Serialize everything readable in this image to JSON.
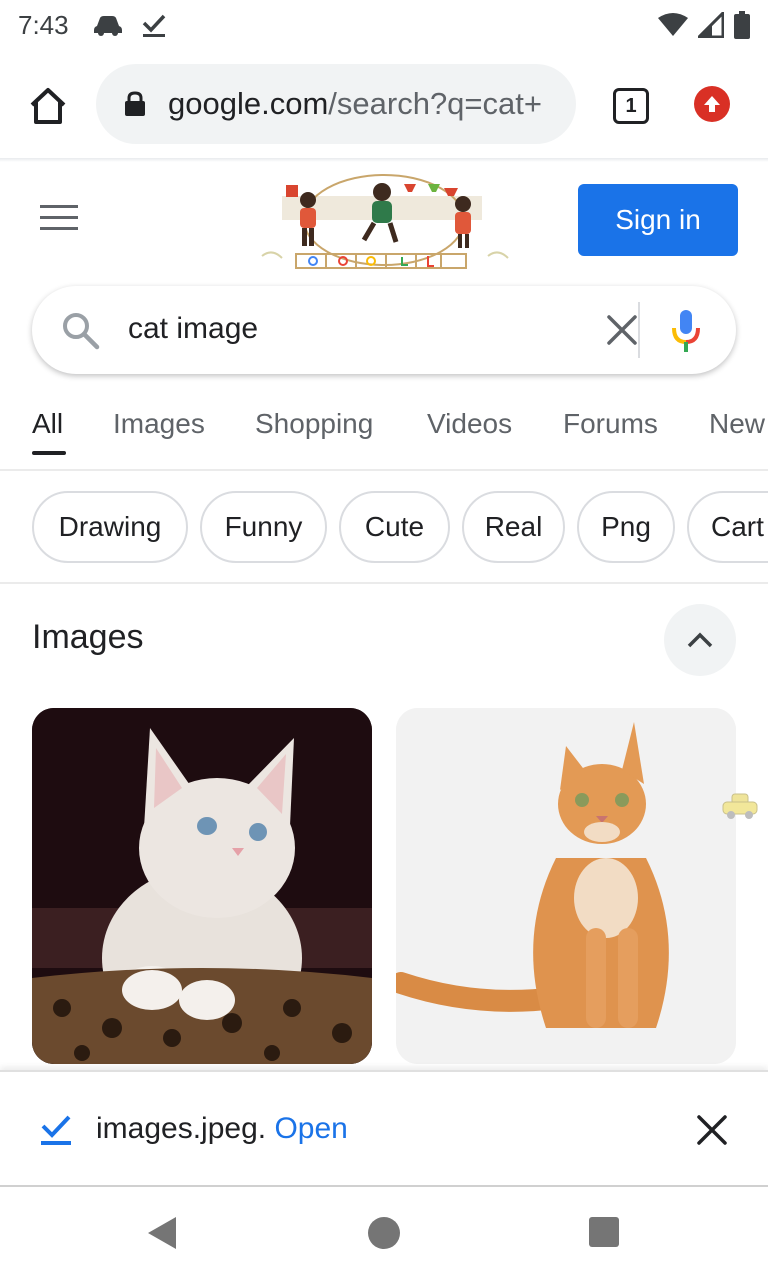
{
  "status_bar": {
    "time": "7:43"
  },
  "browser": {
    "url_domain": "google.com",
    "url_path": "/search?q=cat+",
    "tab_count": "1"
  },
  "header": {
    "sign_in_label": "Sign in"
  },
  "search": {
    "query": "cat image"
  },
  "tabs": [
    {
      "label": "All",
      "active": true
    },
    {
      "label": "Images"
    },
    {
      "label": "Shopping"
    },
    {
      "label": "Videos"
    },
    {
      "label": "Forums"
    },
    {
      "label": "New"
    }
  ],
  "chips": [
    "Drawing",
    "Funny",
    "Cute",
    "Real",
    "Png",
    "Cart"
  ],
  "images_section": {
    "heading": "Images"
  },
  "download": {
    "filename": "images.jpeg.",
    "open_label": "Open"
  },
  "colors": {
    "accent": "#1a73e8",
    "update_badge": "#d93025"
  }
}
